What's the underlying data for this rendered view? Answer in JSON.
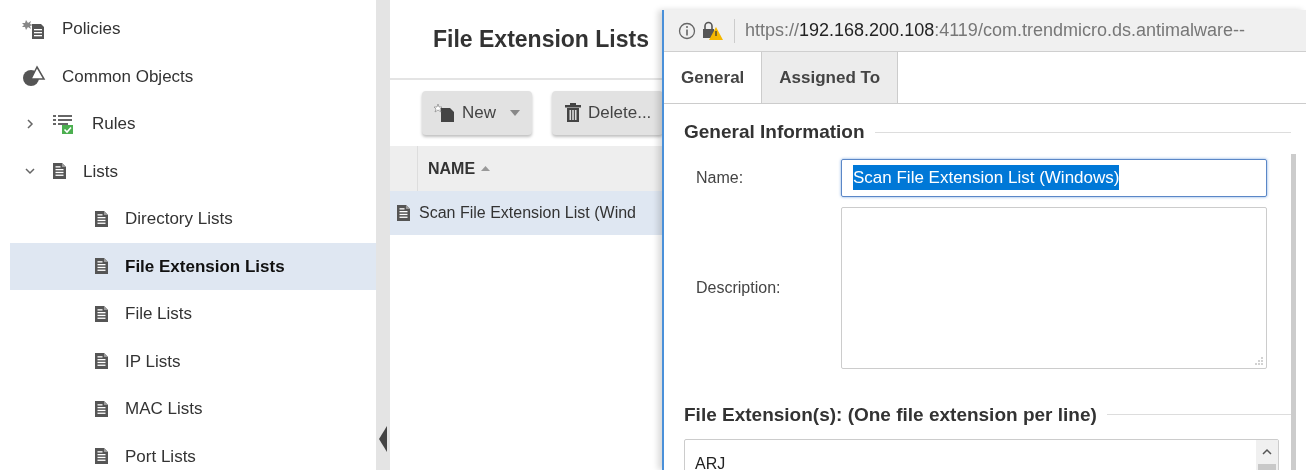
{
  "sidebar": {
    "items": [
      {
        "label": "Policies",
        "kind": "policies",
        "selected": false
      },
      {
        "label": "Common Objects",
        "kind": "objects",
        "selected": false
      },
      {
        "label": "Rules",
        "kind": "rules",
        "selected": false,
        "expanded": false
      },
      {
        "label": "Lists",
        "kind": "list",
        "selected": false,
        "expanded": true,
        "children": [
          {
            "label": "Directory Lists",
            "kind": "list",
            "selected": false
          },
          {
            "label": "File Extension Lists",
            "kind": "list",
            "selected": true
          },
          {
            "label": "File Lists",
            "kind": "list",
            "selected": false
          },
          {
            "label": "IP Lists",
            "kind": "list",
            "selected": false
          },
          {
            "label": "MAC Lists",
            "kind": "list",
            "selected": false
          },
          {
            "label": "Port Lists",
            "kind": "list",
            "selected": false
          }
        ]
      }
    ]
  },
  "main": {
    "title": "File Extension Lists",
    "toolbar": [
      {
        "label": "New",
        "kind": "new"
      },
      {
        "label": "Delete...",
        "kind": "delete"
      }
    ],
    "table": {
      "columns": [
        {
          "label": "NAME",
          "sorted": true
        }
      ],
      "rows": [
        {
          "name": "Scan File Extension List (Wind",
          "selected": true
        }
      ]
    }
  },
  "dialog": {
    "url": {
      "scheme": "https://",
      "host": "192.168.200.108",
      "path": ":4119/com.trendmicro.ds.antimalware--"
    },
    "tabs": [
      {
        "label": "General",
        "selected": true
      },
      {
        "label": "Assigned To",
        "selected": false
      }
    ],
    "general_information": {
      "title": "General Information",
      "name_label": "Name:",
      "name_value": "Scan File Extension List (Windows)",
      "name_text_selected": true,
      "description_label": "Description:"
    },
    "file_extensions": {
      "title": "File Extension(s): (One file extension per line)",
      "lines": [
        "ARJ"
      ]
    }
  }
}
